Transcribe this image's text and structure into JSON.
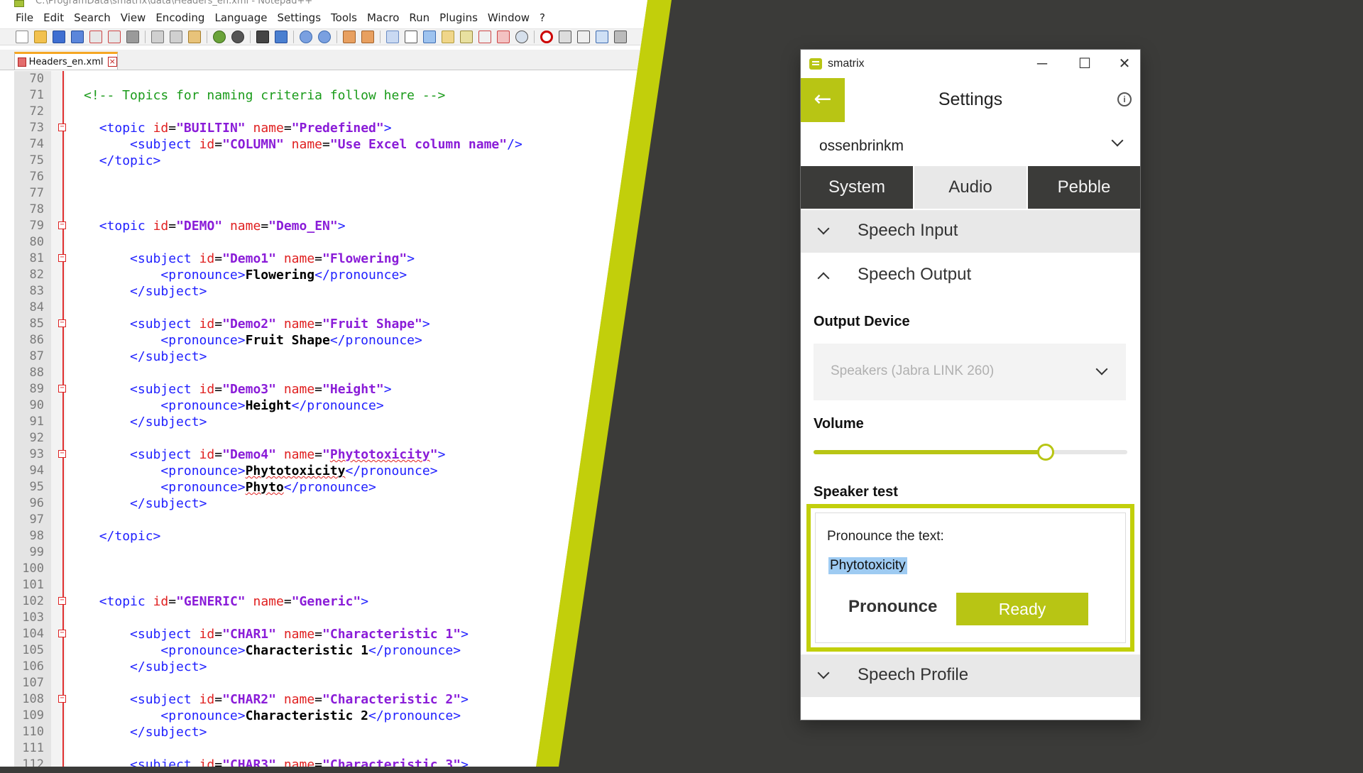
{
  "notepad": {
    "title": "C:\\ProgramData\\smatrix\\data\\Headers_en.xml - Notepad++",
    "menu": [
      "File",
      "Edit",
      "Search",
      "View",
      "Encoding",
      "Language",
      "Settings",
      "Tools",
      "Macro",
      "Run",
      "Plugins",
      "Window",
      "?"
    ],
    "tab_label": "Headers_en.xml",
    "tab_close": "×",
    "line_numbers": [
      "70",
      "71",
      "72",
      "73",
      "74",
      "75",
      "76",
      "77",
      "78",
      "79",
      "80",
      "81",
      "82",
      "83",
      "84",
      "85",
      "86",
      "87",
      "88",
      "89",
      "90",
      "91",
      "92",
      "93",
      "94",
      "95",
      "96",
      "97",
      "98",
      "99",
      "100",
      "101",
      "102",
      "103",
      "104",
      "105",
      "106",
      "107",
      "108",
      "109",
      "110",
      "111",
      "112"
    ]
  },
  "smatrix": {
    "app_title": "smatrix",
    "win_minimize": "─",
    "win_maximize": "☐",
    "win_close": "✕",
    "back_glyph": "←",
    "info_glyph": "i",
    "header_title": "Settings",
    "user": "ossenbrinkm",
    "tabs": {
      "system": "System",
      "audio": "Audio",
      "pebble": "Pebble"
    },
    "sections": {
      "speech_input": "Speech Input",
      "speech_output": "Speech Output",
      "speech_profile": "Speech Profile"
    },
    "output_device_label": "Output Device",
    "output_device_value": "Speakers (Jabra LINK 260)",
    "volume_label": "Volume",
    "volume_level": 0.74,
    "speaker_test_label": "Speaker test",
    "prompt": "Pronounce the text:",
    "phrase": "Phytotoxicity",
    "pronounce_label": "Pronounce",
    "ready_button": "Ready",
    "accent_color": "#b8c514",
    "dark_color": "#3b3b39"
  }
}
